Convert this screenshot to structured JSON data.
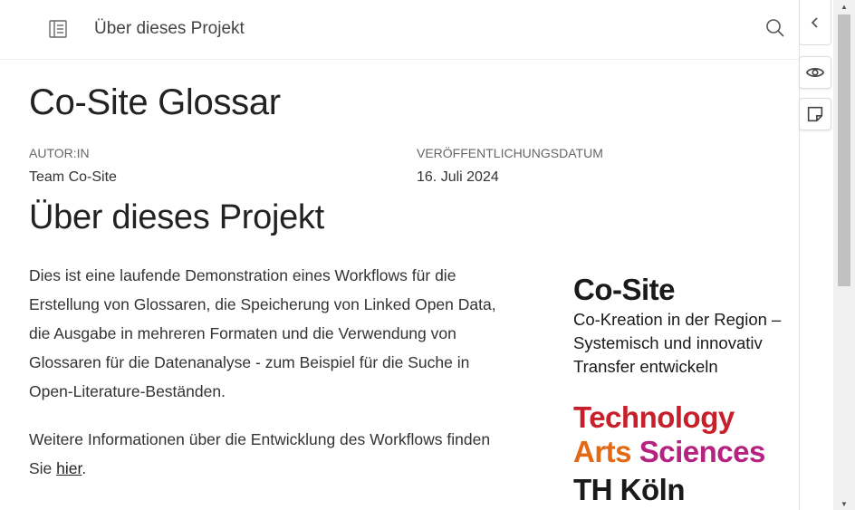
{
  "header": {
    "title": "Über dieses Projekt"
  },
  "document": {
    "title": "Co-Site Glossar",
    "meta": [
      {
        "label": "AUTOR:IN",
        "value": "Team Co-Site"
      },
      {
        "label": "VERÖFFENTLICHUNGSDATUM",
        "value": "16. Juli 2024"
      }
    ],
    "section_title": "Über dieses Projekt",
    "paragraph1": "Dies ist eine laufende Demonstration eines Workflows für die Erstellung von Glossaren, die Speicherung von Linked Open Data, die Ausgabe in mehreren Formaten und die Verwendung von Glossaren für die Datenanalyse - zum Beispiel für die Suche in Open-Literature-Beständen.",
    "paragraph2_prefix": "Weitere Informationen über die Entwicklung des Workflows finden Sie ",
    "paragraph2_link": "hier",
    "paragraph2_suffix": "."
  },
  "cosite_logo": {
    "name": "Co-Site",
    "tagline": [
      "Co-Kreation in der Region –",
      "Systemisch und innovativ",
      "Transfer entwickeln"
    ]
  },
  "th_logo": {
    "line1": "Technology",
    "line2a": "Arts",
    "line2b": "Sciences",
    "line3": "TH Köln",
    "colors": {
      "technology": "#c8202a",
      "arts": "#e26a14",
      "sciences": "#b5227f",
      "th": "#1a1a1a"
    }
  },
  "icons": {
    "toc": "toc-icon",
    "search": "search-icon",
    "collapse": "chevron-left-icon",
    "view": "eye-icon",
    "annotate": "sticky-note-icon"
  }
}
